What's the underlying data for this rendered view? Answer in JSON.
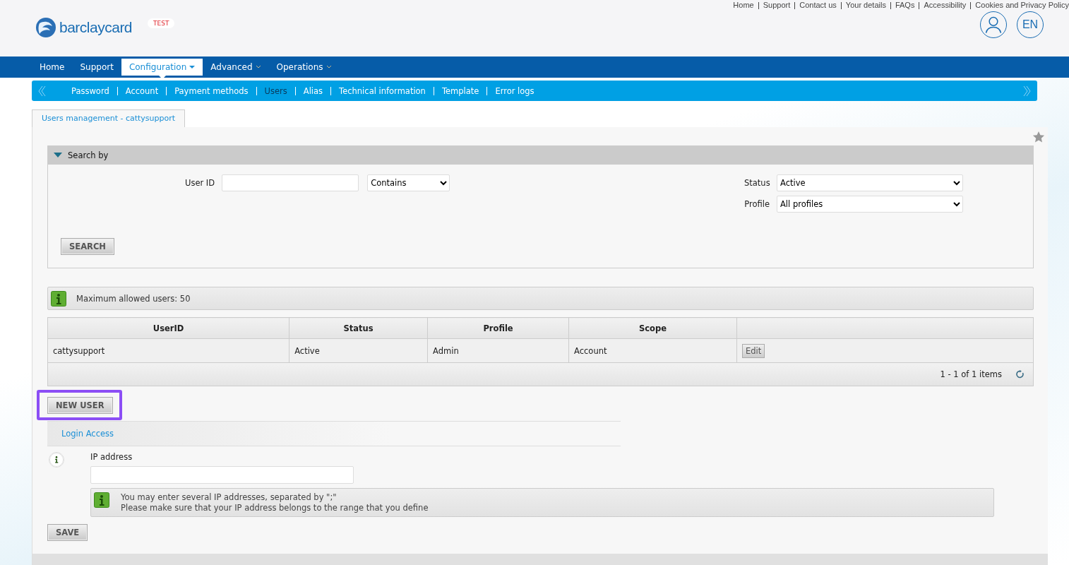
{
  "header": {
    "logo_text": "barclaycard",
    "env_badge": "TEST",
    "top_links": [
      "Home",
      "Support",
      "Contact us",
      "Your details",
      "FAQs",
      "Accessibility",
      "Cookies and Privacy Policy"
    ],
    "language": "EN"
  },
  "main_nav": [
    {
      "label": "Home",
      "selected": false,
      "has_menu": false
    },
    {
      "label": "Support",
      "selected": false,
      "has_menu": false
    },
    {
      "label": "Configuration",
      "selected": true,
      "has_menu": true
    },
    {
      "label": "Advanced",
      "selected": false,
      "has_menu": true
    },
    {
      "label": "Operations",
      "selected": false,
      "has_menu": true
    }
  ],
  "sub_nav": [
    {
      "label": "Password",
      "selected": false
    },
    {
      "label": "Account",
      "selected": false
    },
    {
      "label": "Payment methods",
      "selected": false
    },
    {
      "label": "Users",
      "selected": true
    },
    {
      "label": "Alias",
      "selected": false
    },
    {
      "label": "Technical information",
      "selected": false
    },
    {
      "label": "Template",
      "selected": false
    },
    {
      "label": "Error logs",
      "selected": false
    }
  ],
  "page_tab": "Users management - cattysupport",
  "search": {
    "title": "Search by",
    "expanded": true,
    "user_id_label": "User ID",
    "match": "Contains",
    "status_label": "Status",
    "status": "Active",
    "profile_label": "Profile",
    "profile": "All profiles",
    "button": "SEARCH"
  },
  "info": "Maximum allowed users: 50",
  "table": {
    "columns": [
      "UserID",
      "Status",
      "Profile",
      "Scope"
    ],
    "rows": [
      {
        "cells": [
          "cattysupport",
          "Active",
          "Admin",
          "Account"
        ],
        "action": "Edit"
      }
    ],
    "pager": "1 - 1 of 1 items"
  },
  "new_user": {
    "label": "NEW USER",
    "highlighted": true
  },
  "login_access": {
    "title": "Login Access",
    "ip_label": "IP address",
    "hint_lines": [
      "You may enter several IP addresses, separated by \";\"",
      "Please make sure that your IP address belongs to the range that you define"
    ]
  },
  "save": "SAVE"
}
